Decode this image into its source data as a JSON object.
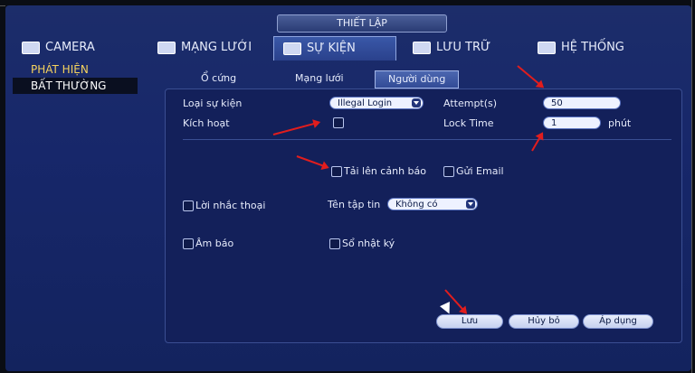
{
  "title": "THIẾT LẬP",
  "tabs": [
    {
      "label": "CAMERA"
    },
    {
      "label": "MẠNG LƯỚI"
    },
    {
      "label": "SỰ KIỆN"
    },
    {
      "label": "LƯU TRỮ"
    },
    {
      "label": "HỆ THỐNG"
    }
  ],
  "sidebar": {
    "items": [
      {
        "label": "PHÁT HIỆN"
      },
      {
        "label": "BẤT THƯỜNG"
      }
    ]
  },
  "subtabs": [
    {
      "label": "Ổ cứng"
    },
    {
      "label": "Mạng lưới"
    },
    {
      "label": "Người dùng"
    }
  ],
  "form": {
    "event_type_label": "Loại sự kiện",
    "event_type_value": "Illegal Login",
    "activate_label": "Kích hoạt",
    "attempts_label": "Attempt(s)",
    "attempts_value": "50",
    "locktime_label": "Lock Time",
    "locktime_value": "1",
    "locktime_unit": "phút",
    "upload_alert_label": "Tải lên cảnh báo",
    "send_email_label": "Gửi Email",
    "voice_prompt_label": "Lời nhắc thoại",
    "filename_label": "Tên tập tin",
    "filename_value": "Không có",
    "buzzer_label": "Âm báo",
    "log_label": "Sổ nhật ký"
  },
  "buttons": {
    "save": "Lưu",
    "cancel": "Hủy bỏ",
    "apply": "Áp dụng"
  }
}
